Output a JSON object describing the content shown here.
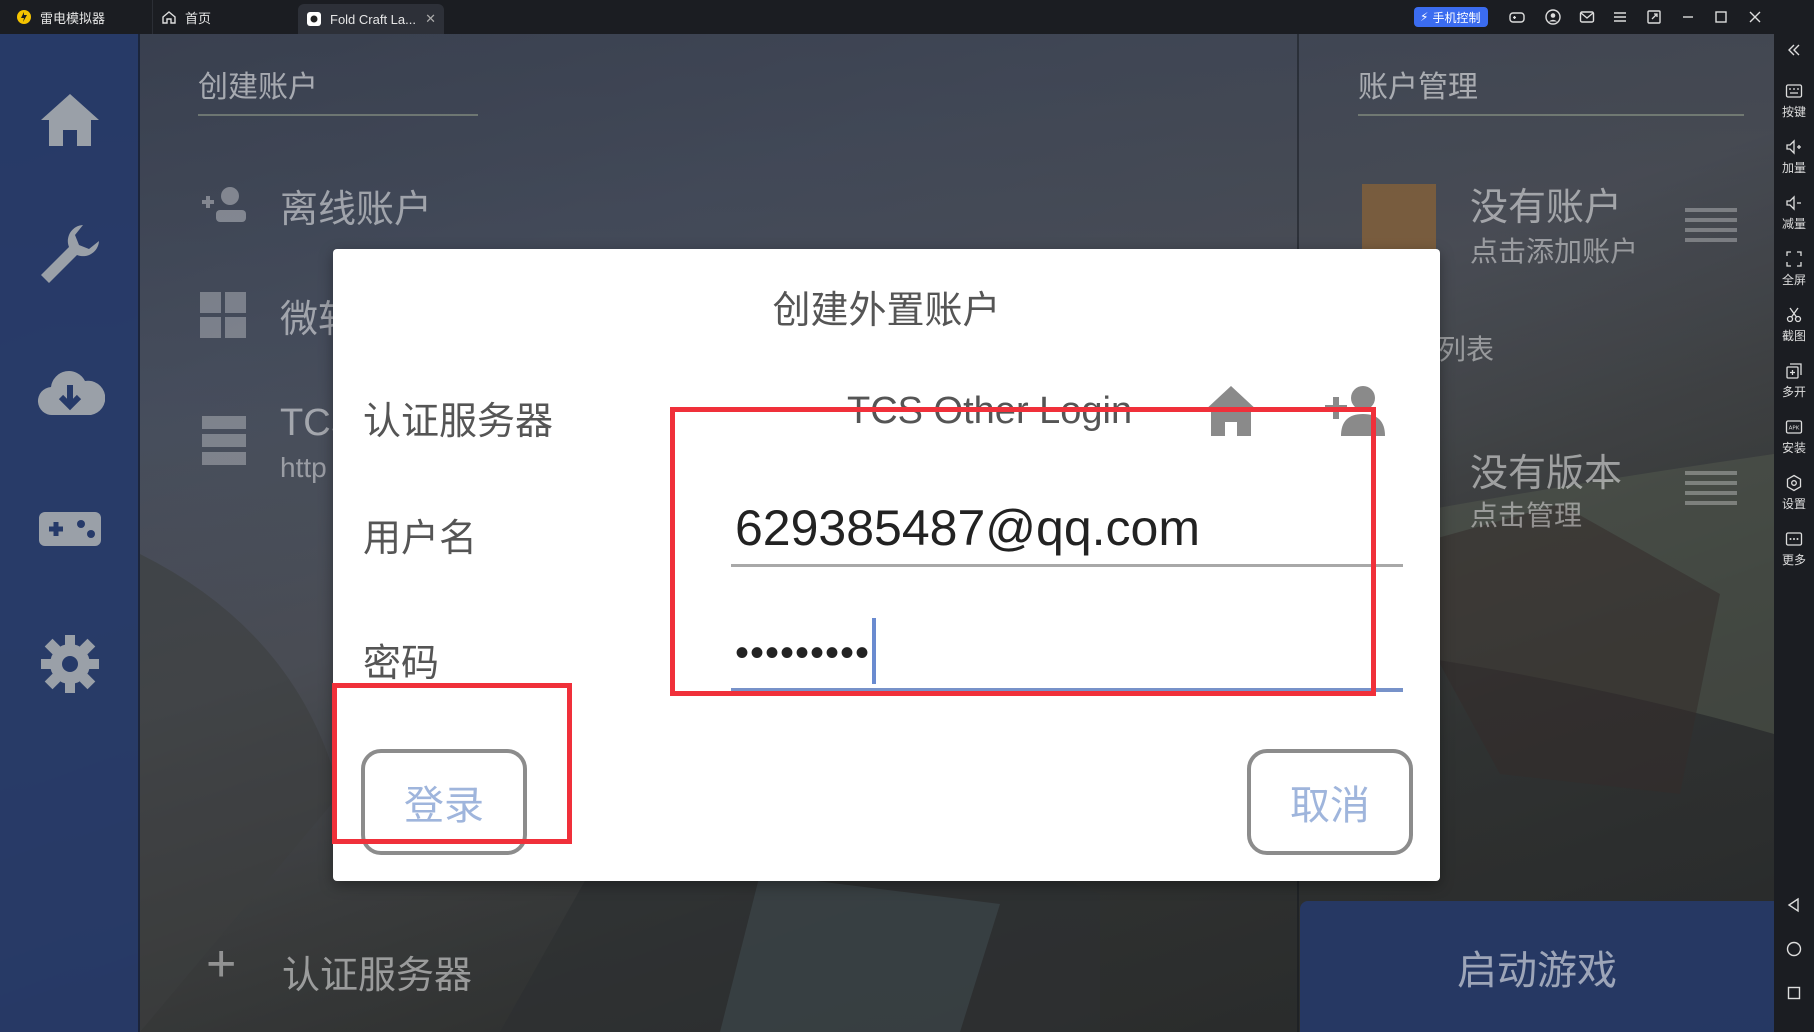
{
  "titlebar": {
    "app_name": "雷电模拟器",
    "tabs": [
      {
        "label": "首页"
      },
      {
        "label": "Fold Craft La..."
      }
    ],
    "phone_control": "手机控制"
  },
  "rightbar": {
    "items": [
      {
        "label": "按键",
        "icon": "keyboard-icon"
      },
      {
        "label": "加量",
        "icon": "volume-up-icon"
      },
      {
        "label": "减量",
        "icon": "volume-down-icon"
      },
      {
        "label": "全屏",
        "icon": "fullscreen-icon"
      },
      {
        "label": "截图",
        "icon": "scissors-icon"
      },
      {
        "label": "多开",
        "icon": "multi-instance-icon"
      },
      {
        "label": "安装",
        "icon": "apk-icon"
      },
      {
        "label": "设置",
        "icon": "gear-icon"
      },
      {
        "label": "更多",
        "icon": "more-icon"
      }
    ]
  },
  "background": {
    "left_title": "创建账户",
    "left_items": [
      {
        "label": "离线账户"
      },
      {
        "label": "微软"
      },
      {
        "label": "TCS"
      }
    ],
    "left_sub": "http",
    "auth_server": "认证服务器",
    "right_title": "账户管理",
    "no_account": "没有账户",
    "add_account": "点击添加账户",
    "list_partial": "列表",
    "no_version": "没有版本",
    "manage": "点击管理",
    "launch": "启动游戏"
  },
  "dialog": {
    "title": "创建外置账户",
    "server_label": "认证服务器",
    "server_name": "TCS Other Login",
    "username_label": "用户名",
    "username_value": "629385487@qq.com",
    "password_label": "密码",
    "password_masked": "•••••••••",
    "login_button": "登录",
    "cancel_button": "取消"
  },
  "colors": {
    "highlight": "#f0303a",
    "nav": "#263a69",
    "button_text": "#9fb5dc",
    "focus_underline": "#7792c9"
  }
}
